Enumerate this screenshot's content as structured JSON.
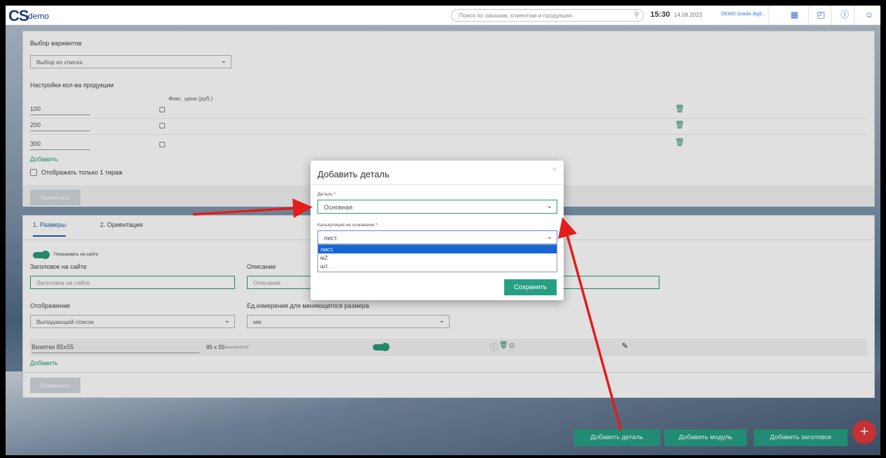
{
  "header": {
    "logo": "CS",
    "logo_sub": "demo",
    "search_placeholder": "Поиск по заказам, клиентам и продукции",
    "time": "15:30",
    "date": "14.08.2023",
    "user": "DEMO (ivasbi digit..."
  },
  "panel1": {
    "variants_label": "Выбор вариантов",
    "variants_value": "Выбор из списка",
    "qty_label": "Настройки кол-ва продукции",
    "fix_price_label": "Фикс. цена (руб.)",
    "rows": [
      {
        "qty": "100"
      },
      {
        "qty": "200"
      },
      {
        "qty": "300"
      }
    ],
    "add_link": "Добавить",
    "single_run_label": "Отображать только 1 тираж",
    "apply_button": "Применить"
  },
  "panel2": {
    "tabs": [
      "1. Размеры",
      "2. Ориентация"
    ],
    "show_on_site": "Показывать на сайте",
    "site_title_label": "Заголовок на сайте",
    "site_title_placeholder": "Заголовок на сайте",
    "description_label": "Описание",
    "description_placeholder": "Описание",
    "display_label": "Отображение",
    "display_value": "Выпадающий список",
    "units_label": "Ед.измерения для меняющегося размера",
    "units_value": "мм",
    "size_row_name": "Визитки 85x55",
    "size_row_dims": "85 x 55",
    "size_row_note": "Визитки 85x55",
    "add_link": "Добавить",
    "apply_button": "Применить"
  },
  "modal": {
    "title": "Добавить деталь",
    "close": "×",
    "detail_label": "Деталь *",
    "detail_value": "Основная",
    "calc_label": "Калькуляция на основании *",
    "calc_value": "лист.",
    "options": [
      "лист.",
      "м2",
      "шт."
    ],
    "save_button": "Сохранить"
  },
  "footer": {
    "add_detail": "Добавить деталь",
    "add_module": "Добавить модуль",
    "add_header": "Добавить заголовок",
    "fab": "+"
  },
  "colors": {
    "accent": "#26a083",
    "brand": "#1e3a78",
    "arrow": "#e41c1c",
    "fab": "#e03a3a"
  }
}
